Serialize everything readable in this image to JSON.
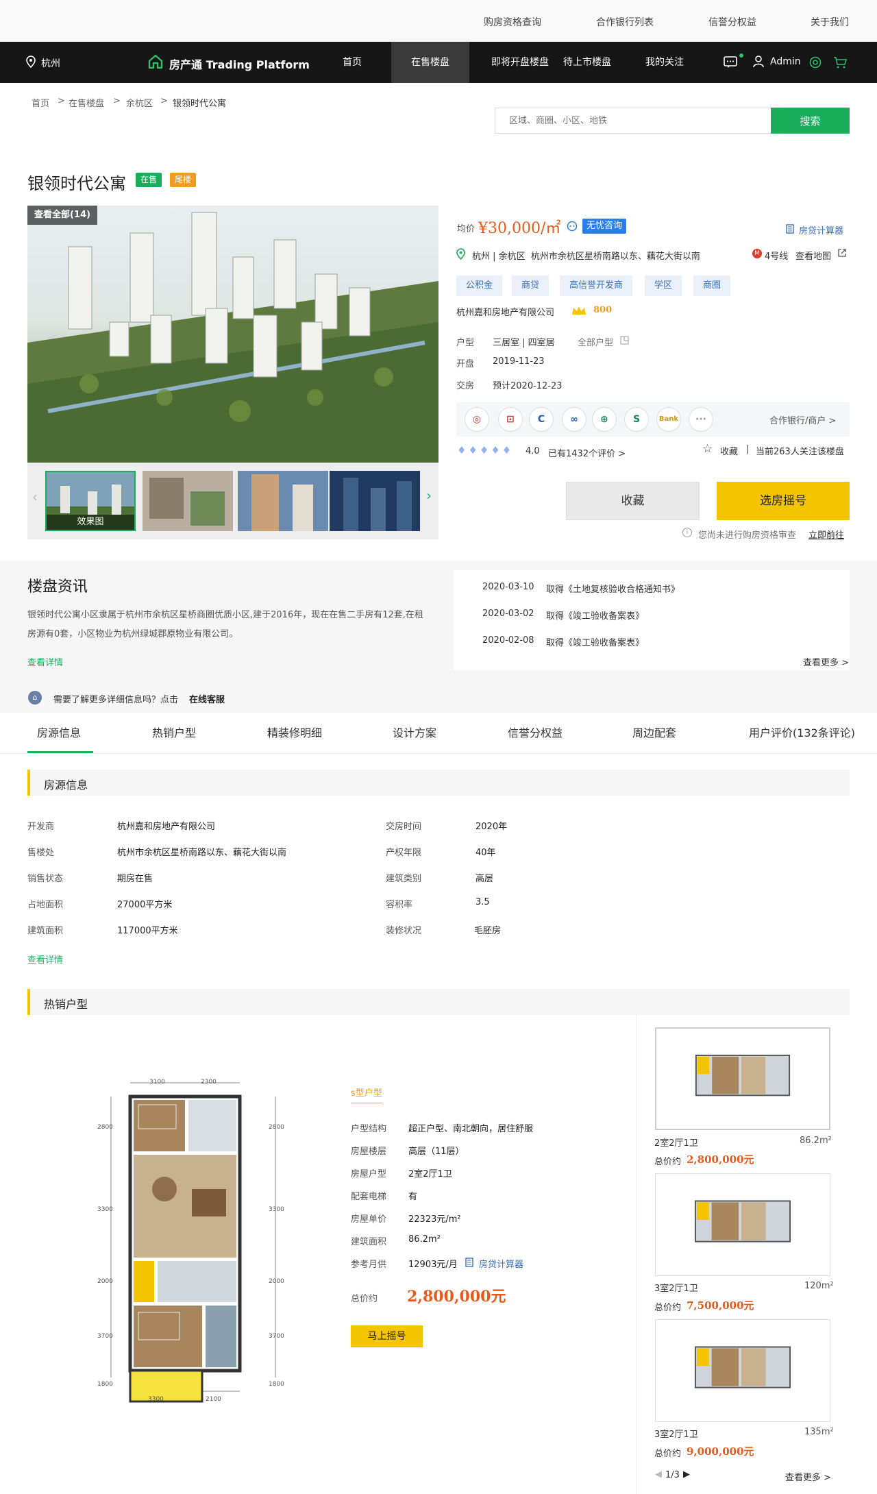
{
  "topbar": {
    "links": [
      "购房资格查询",
      "合作银行列表",
      "信誉分权益",
      "关于我们"
    ]
  },
  "nav": {
    "city": "杭州",
    "brand": "房产通 Trading Platform",
    "items": [
      "首页",
      "在售楼盘",
      "即将开盘楼盘",
      "待上市楼盘",
      "我的关注"
    ],
    "user": "Admin"
  },
  "breadcrumb": [
    "首页",
    "在售楼盘",
    "余杭区",
    "银领时代公寓"
  ],
  "search": {
    "placeholder": "区域、商圈、小区、地铁",
    "button": "搜索"
  },
  "property": {
    "name": "银领时代公寓",
    "tags": [
      "在售",
      "尾楼"
    ],
    "view_all": "查看全部(14)",
    "thumb_caption": "效果图",
    "price_label": "均价",
    "price": "¥30,000/㎡",
    "consult": "无忧咨询",
    "calculator": "房贷计算器",
    "location": "杭州 | 余杭区  杭州市余杭区星桥南路以东、藕花大街以南",
    "metro": "4号线",
    "map_link": "查看地图",
    "features": [
      "公积金",
      "商贷",
      "高信誉开发商",
      "学区",
      "商圈"
    ],
    "developer": "杭州嘉和房地产有限公司",
    "dev_score": "800",
    "layout_label": "户型",
    "layouts": "三居室 | 四室居",
    "all_layouts": "全部户型",
    "open_label": "开盘",
    "open_date": "2019-11-23",
    "delivery_label": "交房",
    "delivery_date": "预计2020-12-23",
    "banks_link": "合作银行/商户 >",
    "rating": "4.0",
    "reviews": "已有1432个评价 >",
    "fav": "收藏",
    "followers": "当前263人关注该楼盘",
    "btn_fav": "收藏",
    "btn_lottery": "选房摇号",
    "notice": "您尚未进行购房资格审查",
    "notice_link": "立即前往"
  },
  "news": {
    "title": "楼盘资讯",
    "desc": "银领时代公寓小区隶属于杭州市余杭区星桥商圈优质小区,建于2016年，现在在售二手房有12套,在租房源有0套，小区物业为杭州绿城郡原物业有限公司。",
    "more": "查看详情",
    "items": [
      {
        "date": "2020-03-10",
        "text": "取得《土地复核验收合格通知书》"
      },
      {
        "date": "2020-03-02",
        "text": "取得《竣工验收备案表》"
      },
      {
        "date": "2020-02-08",
        "text": "取得《竣工验收备案表》"
      }
    ],
    "see_more": "查看更多 >",
    "service_q": "需要了解更多详细信息吗？点击",
    "service_link": "在线客服"
  },
  "tabs": [
    "房源信息",
    "热销户型",
    "精装修明细",
    "设计方案",
    "信誉分权益",
    "周边配套",
    "用户评价(132条评论)"
  ],
  "info": {
    "title": "房源信息",
    "left": [
      {
        "k": "开发商",
        "v": "杭州嘉和房地产有限公司"
      },
      {
        "k": "售楼处",
        "v": "杭州市余杭区星桥南路以东、藕花大街以南"
      },
      {
        "k": "销售状态",
        "v": "期房在售"
      },
      {
        "k": "占地面积",
        "v": "27000平方米"
      },
      {
        "k": "建筑面积",
        "v": "117000平方米"
      }
    ],
    "right": [
      {
        "k": "交房时间",
        "v": "2020年"
      },
      {
        "k": "产权年限",
        "v": "40年"
      },
      {
        "k": "建筑类别",
        "v": "高层"
      },
      {
        "k": "容积率",
        "v": "3.5"
      },
      {
        "k": "装修状况",
        "v": "毛胚房"
      }
    ],
    "more": "查看详情"
  },
  "hot": {
    "title": "热销户型",
    "plan_type": "s型户型",
    "dims": {
      "top": [
        "3100",
        "2300"
      ],
      "bottom": [
        "3300",
        "2100"
      ],
      "left": [
        "2800",
        "3300",
        "2000",
        "3700",
        "1800"
      ],
      "right": [
        "2800",
        "3300",
        "2000",
        "3700",
        "1800"
      ]
    },
    "fields": [
      {
        "k": "户型结构",
        "v": "超正户型、南北朝向，居住舒服"
      },
      {
        "k": "房屋楼层",
        "v": "高层（11层）"
      },
      {
        "k": "房屋户型",
        "v": "2室2厅1卫"
      },
      {
        "k": "配套电梯",
        "v": "有"
      },
      {
        "k": "房屋单价",
        "v": "22323元/m²"
      },
      {
        "k": "建筑面积",
        "v": "86.2m²"
      },
      {
        "k": "参考月供",
        "v": "12903元/月"
      }
    ],
    "calc": "房贷计算器",
    "total_label": "总价约",
    "total": "2,800,000元",
    "cta": "马上摇号",
    "cards": [
      {
        "layout": "2室2厅1卫",
        "area": "86.2m²",
        "label": "总价约",
        "price": "2,800,000元"
      },
      {
        "layout": "3室2厅1卫",
        "area": "120m²",
        "label": "总价约",
        "price": "7,500,000元"
      },
      {
        "layout": "3室2厅1卫",
        "area": "135m²",
        "label": "总价约",
        "price": "9,000,000元"
      }
    ],
    "pager": "1/3",
    "see_more": "查看更多 >"
  }
}
